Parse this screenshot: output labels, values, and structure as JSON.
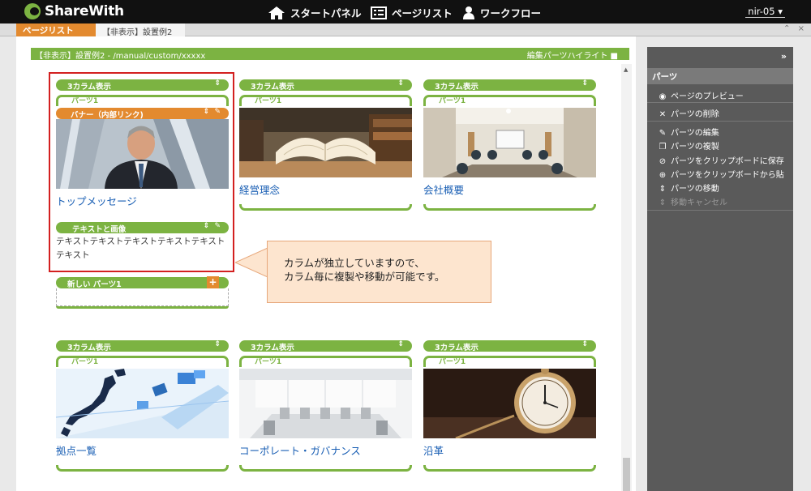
{
  "app": {
    "name": "ShareWith"
  },
  "header": {
    "nav": [
      {
        "label": "スタートパネル",
        "icon": "home-icon"
      },
      {
        "label": "ページリスト",
        "icon": "list-icon"
      },
      {
        "label": "ワークフロー",
        "icon": "person-icon"
      }
    ],
    "user": "nir-05"
  },
  "tabs": {
    "section": "ページリスト",
    "current": "【非表示】設置例2"
  },
  "page": {
    "path": "【非表示】設置例2 - /manual/custom/xxxxx",
    "highlight_label": "編集パーツハイライト"
  },
  "columns_row1": [
    {
      "head": "3カラム表示",
      "part": "パーツ1",
      "banner": "バナー（内部リンク)",
      "caption": "トップメッセージ",
      "text_head": "テキストと画像",
      "text": "テキストテキストテキストテキストテキストテキスト"
    },
    {
      "head": "3カラム表示",
      "part": "パーツ1",
      "caption": "経営理念"
    },
    {
      "head": "3カラム表示",
      "part": "パーツ1",
      "caption": "会社概要"
    }
  ],
  "new_part": {
    "label": "新しい パーツ1",
    "plus": "+"
  },
  "callout": {
    "line1": "カラムが独立していますので、",
    "line2": "カラム毎に複製や移動が可能です。"
  },
  "columns_row2": [
    {
      "head": "3カラム表示",
      "part": "パーツ1",
      "caption": "拠点一覧"
    },
    {
      "head": "3カラム表示",
      "part": "パーツ1",
      "caption": "コーポレート・ガバナンス"
    },
    {
      "head": "3カラム表示",
      "part": "パーツ1",
      "caption": "沿革"
    }
  ],
  "sidebar": {
    "title": "パーツ",
    "items": [
      {
        "label": "ページのプレビュー",
        "icon": "eye-icon",
        "enabled": true
      },
      {
        "label": "パーツの削除",
        "icon": "close-icon",
        "enabled": true
      },
      {
        "label": "パーツの編集",
        "icon": "pencil-icon",
        "enabled": true
      },
      {
        "label": "パーツの複製",
        "icon": "duplicate-icon",
        "enabled": true
      },
      {
        "label": "パーツをクリップボードに保存",
        "icon": "paperclip-icon",
        "enabled": true
      },
      {
        "label": "パーツをクリップボードから貼",
        "icon": "paste-icon",
        "enabled": true
      },
      {
        "label": "パーツの移動",
        "icon": "move-icon",
        "enabled": true
      },
      {
        "label": "移動キャンセル",
        "icon": "move-cancel-icon",
        "enabled": false
      }
    ]
  },
  "colors": {
    "accent_green": "#7cb342",
    "accent_orange": "#e38a2f",
    "link_blue": "#1a5fb4",
    "highlight_red": "#d32020"
  }
}
